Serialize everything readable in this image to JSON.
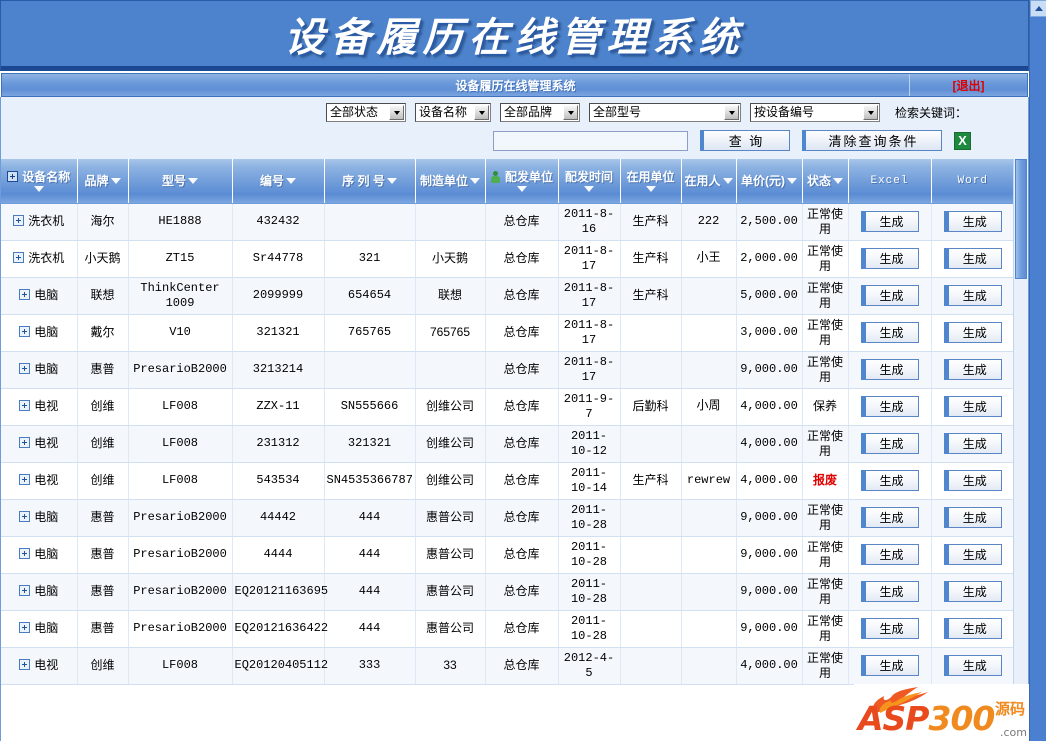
{
  "banner": {
    "title": "设备履历在线管理系统"
  },
  "subbar": {
    "title": "设备履历在线管理系统",
    "logout": "[退出]"
  },
  "toolbar": {
    "status_select": "全部状态",
    "name_select": "设备名称",
    "brand_select": "全部品牌",
    "model_select": "全部型号",
    "by_select": "按设备编号",
    "keyword_label": "检索关键词：",
    "keyword_value": "",
    "keyword_placeholder": "",
    "query_button": "查 询",
    "clear_button": "清除查询条件",
    "excel_export_icon": "excel-export-icon"
  },
  "table": {
    "columns": [
      {
        "label": "设备名称",
        "sortable": true,
        "expand": true
      },
      {
        "label": "品牌",
        "sortable": true
      },
      {
        "label": "型号",
        "sortable": true
      },
      {
        "label": "编号",
        "sortable": true
      },
      {
        "label": "序 列 号",
        "sortable": true
      },
      {
        "label": "制造单位",
        "sortable": true
      },
      {
        "label": "配发单位",
        "sortable": true,
        "person": true
      },
      {
        "label": "配发时间",
        "sortable": true
      },
      {
        "label": "在用单位",
        "sortable": true
      },
      {
        "label": "在用人",
        "sortable": true
      },
      {
        "label": "单价(元)",
        "sortable": true
      },
      {
        "label": "状态",
        "sortable": true
      },
      {
        "label": "Excel",
        "sortable": false,
        "mono": true
      },
      {
        "label": "Word",
        "sortable": false,
        "mono": true
      }
    ],
    "generate_label": "生成",
    "rows": [
      {
        "name": "洗衣机",
        "brand": "海尔",
        "model": "HE1888",
        "code": "432432",
        "serial": "",
        "maker": "",
        "issue_unit": "总仓库",
        "issue_date": "2011-8-16",
        "use_unit": "生产科",
        "user": "222",
        "price": "2,500.00",
        "status": "正常使用",
        "scrap": false
      },
      {
        "name": "洗衣机",
        "brand": "小天鹅",
        "model": "ZT15",
        "code": "Sr44778",
        "serial": "321",
        "maker": "小天鹅",
        "issue_unit": "总仓库",
        "issue_date": "2011-8-17",
        "use_unit": "生产科",
        "user": "小王",
        "price": "2,000.00",
        "status": "正常使用",
        "scrap": false
      },
      {
        "name": "电脑",
        "brand": "联想",
        "model": "ThinkCenter 1009",
        "code": "2099999",
        "serial": "654654",
        "maker": "联想",
        "issue_unit": "总仓库",
        "issue_date": "2011-8-17",
        "use_unit": "生产科",
        "user": "",
        "price": "5,000.00",
        "status": "正常使用",
        "scrap": false
      },
      {
        "name": "电脑",
        "brand": "戴尔",
        "model": "V10",
        "code": "321321",
        "serial": "765765",
        "maker": "765765",
        "issue_unit": "总仓库",
        "issue_date": "2011-8-17",
        "use_unit": "",
        "user": "",
        "price": "3,000.00",
        "status": "正常使用",
        "scrap": false
      },
      {
        "name": "电脑",
        "brand": "惠普",
        "model": "PresarioB2000",
        "code": "3213214",
        "serial": "",
        "maker": "",
        "issue_unit": "总仓库",
        "issue_date": "2011-8-17",
        "use_unit": "",
        "user": "",
        "price": "9,000.00",
        "status": "正常使用",
        "scrap": false
      },
      {
        "name": "电视",
        "brand": "创维",
        "model": "LF008",
        "code": "ZZX-11",
        "serial": "SN555666",
        "maker": "创维公司",
        "issue_unit": "总仓库",
        "issue_date": "2011-9-7",
        "use_unit": "后勤科",
        "user": "小周",
        "price": "4,000.00",
        "status": "保养",
        "scrap": false
      },
      {
        "name": "电视",
        "brand": "创维",
        "model": "LF008",
        "code": "231312",
        "serial": "321321",
        "maker": "创维公司",
        "issue_unit": "总仓库",
        "issue_date": "2011-10-12",
        "use_unit": "",
        "user": "",
        "price": "4,000.00",
        "status": "正常使用",
        "scrap": false
      },
      {
        "name": "电视",
        "brand": "创维",
        "model": "LF008",
        "code": "543534",
        "serial": "SN4535366787",
        "maker": "创维公司",
        "issue_unit": "总仓库",
        "issue_date": "2011-10-14",
        "use_unit": "生产科",
        "user": "rewrew",
        "price": "4,000.00",
        "status": "报废",
        "scrap": true
      },
      {
        "name": "电脑",
        "brand": "惠普",
        "model": "PresarioB2000",
        "code": "44442",
        "serial": "444",
        "maker": "惠普公司",
        "issue_unit": "总仓库",
        "issue_date": "2011-10-28",
        "use_unit": "",
        "user": "",
        "price": "9,000.00",
        "status": "正常使用",
        "scrap": false
      },
      {
        "name": "电脑",
        "brand": "惠普",
        "model": "PresarioB2000",
        "code": "4444",
        "serial": "444",
        "maker": "惠普公司",
        "issue_unit": "总仓库",
        "issue_date": "2011-10-28",
        "use_unit": "",
        "user": "",
        "price": "9,000.00",
        "status": "正常使用",
        "scrap": false
      },
      {
        "name": "电脑",
        "brand": "惠普",
        "model": "PresarioB2000",
        "code": "EQ20121163695",
        "serial": "444",
        "maker": "惠普公司",
        "issue_unit": "总仓库",
        "issue_date": "2011-10-28",
        "use_unit": "",
        "user": "",
        "price": "9,000.00",
        "status": "正常使用",
        "scrap": false
      },
      {
        "name": "电脑",
        "brand": "惠普",
        "model": "PresarioB2000",
        "code": "EQ20121636422",
        "serial": "444",
        "maker": "惠普公司",
        "issue_unit": "总仓库",
        "issue_date": "2011-10-28",
        "use_unit": "",
        "user": "",
        "price": "9,000.00",
        "status": "正常使用",
        "scrap": false
      },
      {
        "name": "电视",
        "brand": "创维",
        "model": "LF008",
        "code": "EQ20120405112",
        "serial": "333",
        "maker": "33",
        "issue_unit": "总仓库",
        "issue_date": "2012-4-5",
        "use_unit": "",
        "user": "",
        "price": "4,000.00",
        "status": "正常使用",
        "scrap": false
      }
    ]
  },
  "watermark": {
    "asp": "ASP",
    "num": "300",
    "cn": "源码",
    "com": ".com"
  }
}
